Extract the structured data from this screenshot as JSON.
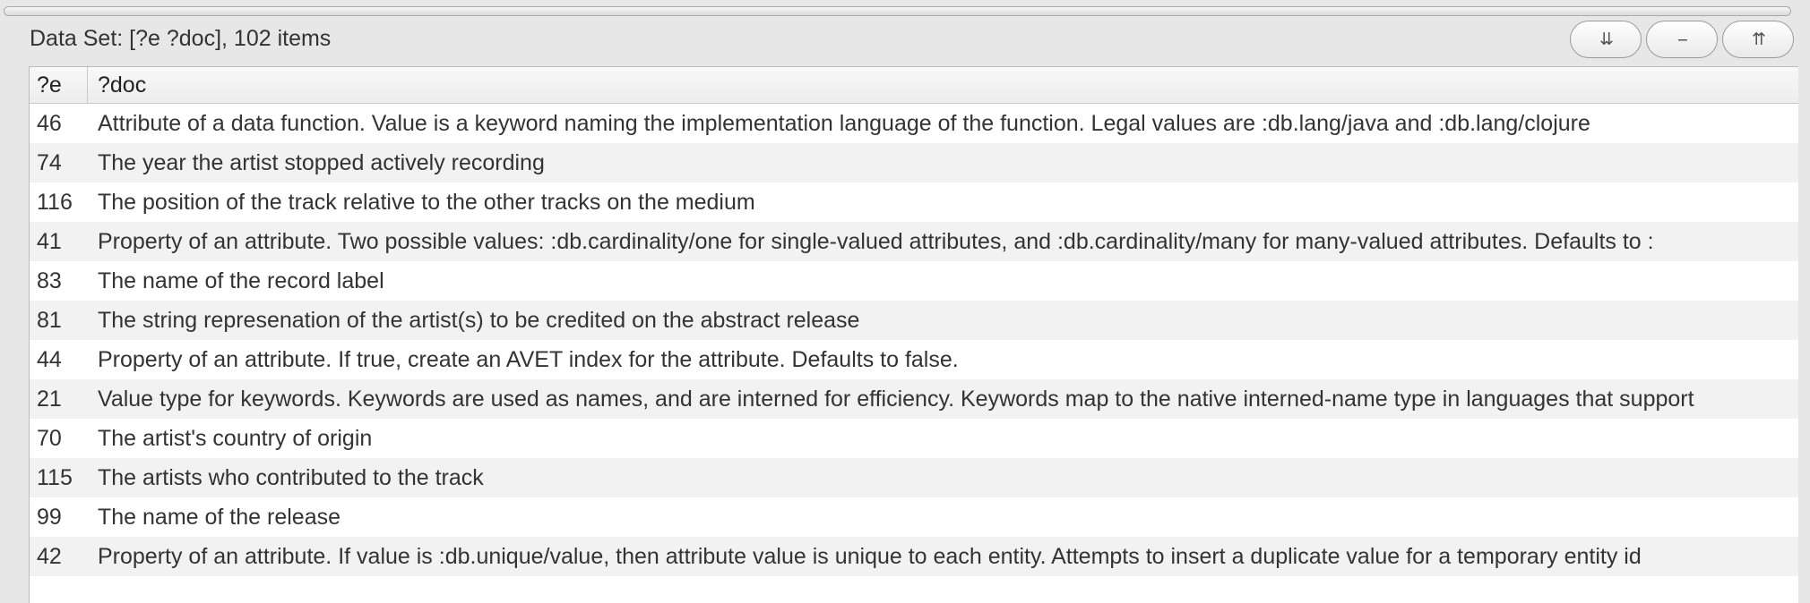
{
  "dataset": {
    "title": "Data Set: [?e ?doc], 102 items",
    "buttons": {
      "expand_all_label": "⇊",
      "collapse_label": "--",
      "collapse_all_label": "⇈"
    },
    "columns": {
      "e": "?e",
      "doc": "?doc"
    },
    "rows": [
      {
        "e": "46",
        "doc": "Attribute of a data function. Value is a keyword naming the implementation language of the function. Legal values are :db.lang/java and :db.lang/clojure"
      },
      {
        "e": "74",
        "doc": "The year the artist stopped actively recording"
      },
      {
        "e": "116",
        "doc": "The position of the track relative to the other tracks on the medium"
      },
      {
        "e": "41",
        "doc": "Property of an attribute. Two possible values: :db.cardinality/one for single-valued attributes, and :db.cardinality/many for many-valued attributes. Defaults to :"
      },
      {
        "e": "83",
        "doc": "The name of the record label"
      },
      {
        "e": "81",
        "doc": "The string represenation of the artist(s) to be credited on the abstract release"
      },
      {
        "e": "44",
        "doc": "Property of an attribute. If true, create an AVET index for the attribute. Defaults to false."
      },
      {
        "e": "21",
        "doc": "Value type for keywords. Keywords are used as names, and are interned for efficiency. Keywords map to the native interned-name type in languages that support"
      },
      {
        "e": "70",
        "doc": "The artist's country of origin"
      },
      {
        "e": "115",
        "doc": "The artists who contributed to the track"
      },
      {
        "e": "99",
        "doc": "The name of the release"
      },
      {
        "e": "42",
        "doc": "Property of an attribute. If value is :db.unique/value, then attribute value is unique to each entity. Attempts to insert a duplicate value for a temporary entity id"
      },
      {
        "e": "",
        "doc": ""
      }
    ]
  }
}
